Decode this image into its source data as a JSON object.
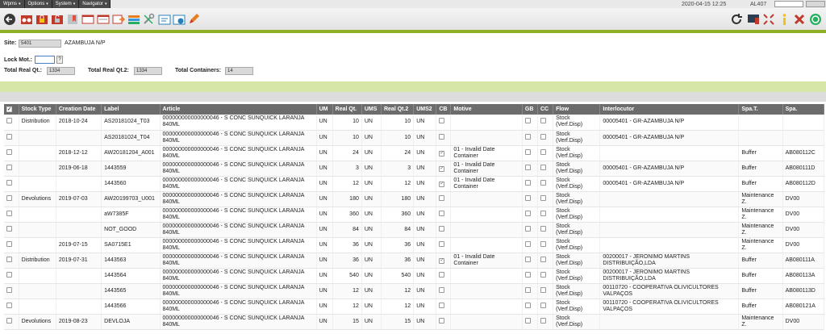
{
  "menu": {
    "items": [
      {
        "label": "Wpms"
      },
      {
        "label": "Options"
      },
      {
        "label": "System"
      },
      {
        "label": "Navigator"
      }
    ],
    "date": "2020-04-15 12:25",
    "user": "AL407"
  },
  "toolbar": {
    "left_icons": [
      "back-arrow-icon",
      "binoculars-icon",
      "lock-icon",
      "unlock-icon",
      "bookmark-icon",
      "window-icon",
      "form-arrow-icon",
      "list-icon",
      "tools-icon",
      "note-icon",
      "globe-window-icon",
      "pencil-icon"
    ],
    "right_icons": [
      "refresh-icon",
      "monitor-icon",
      "expand-icon",
      "info-icon",
      "close-icon",
      "exit-icon"
    ]
  },
  "form": {
    "site_label": "Site:",
    "site_value": "5401",
    "site_name": "AZAMBUJA N/P",
    "lock_label": "Lock Mot.:",
    "lock_btn": "?",
    "total_real_label": "Total Real Qt.:",
    "total_real_value": "1334",
    "total_real2_label": "Total Real Qt.2:",
    "total_real2_value": "1334",
    "total_containers_label": "Total Containers:",
    "total_containers_value": "14"
  },
  "table": {
    "headers": [
      "",
      "Stock Type",
      "Creation Date",
      "Label",
      "Article",
      "UM",
      "Real Qt.",
      "UMS",
      "Real Qt.2",
      "UMS2",
      "CB",
      "Motive",
      "GB",
      "CC",
      "Flow",
      "Interlocutor",
      "Spa.T.",
      "Spa."
    ],
    "rows": [
      {
        "stock_type": "Distribution",
        "date": "2018-10-24",
        "label": "AS20181024_T03",
        "article": "000000000000000046 - S CONC SUNQUICK LARANJA 840ML",
        "um": "UN",
        "real": "10",
        "ums": "UN",
        "real2": "10",
        "ums2": "UN",
        "cb": false,
        "motive": "",
        "flow": "Stock (Verf.Disp)",
        "interlocutor": "00005401 - GR-AZAMBUJA N/P",
        "spat": "",
        "spa": ""
      },
      {
        "stock_type": "",
        "date": "",
        "label": "AS20181024_T04",
        "article": "000000000000000046 - S CONC SUNQUICK LARANJA 840ML",
        "um": "UN",
        "real": "10",
        "ums": "UN",
        "real2": "10",
        "ums2": "UN",
        "cb": false,
        "motive": "",
        "flow": "Stock (Verf.Disp)",
        "interlocutor": "00005401 - GR-AZAMBUJA N/P",
        "spat": "",
        "spa": ""
      },
      {
        "stock_type": "",
        "date": "2018-12-12",
        "label": "AW20181204_A001",
        "article": "000000000000000046 - S CONC SUNQUICK LARANJA 840ML",
        "um": "UN",
        "real": "24",
        "ums": "UN",
        "real2": "24",
        "ums2": "UN",
        "cb": true,
        "motive": "01 - Invalid Date Container",
        "flow": "Stock (Verf.Disp)",
        "interlocutor": "",
        "spat": "Buffer",
        "spa": "AB080112C"
      },
      {
        "stock_type": "",
        "date": "2019-06-18",
        "label": "1443559",
        "article": "000000000000000046 - S CONC SUNQUICK LARANJA 840ML",
        "um": "UN",
        "real": "3",
        "ums": "UN",
        "real2": "3",
        "ums2": "UN",
        "cb": true,
        "motive": "01 - Invalid Date Container",
        "flow": "Stock (Verf.Disp)",
        "interlocutor": "00005401 - GR-AZAMBUJA N/P",
        "spat": "Buffer",
        "spa": "AB080111D"
      },
      {
        "stock_type": "",
        "date": "",
        "label": "1443560",
        "article": "000000000000000046 - S CONC SUNQUICK LARANJA 840ML",
        "um": "UN",
        "real": "12",
        "ums": "UN",
        "real2": "12",
        "ums2": "UN",
        "cb": true,
        "motive": "01 - Invalid Date Container",
        "flow": "Stock (Verf.Disp)",
        "interlocutor": "00005401 - GR-AZAMBUJA N/P",
        "spat": "Buffer",
        "spa": "AB080112D"
      },
      {
        "stock_type": "Devolutions",
        "date": "2019-07-03",
        "label": "AW20199703_U001",
        "article": "000000000000000046 - S CONC SUNQUICK LARANJA 840ML",
        "um": "UN",
        "real": "180",
        "ums": "UN",
        "real2": "180",
        "ums2": "UN",
        "cb": false,
        "motive": "",
        "flow": "Stock (Verf.Disp)",
        "interlocutor": "",
        "spat": "Maintenance Z.",
        "spa": "DV00"
      },
      {
        "stock_type": "",
        "date": "",
        "label": "aW7385F",
        "article": "000000000000000046 - S CONC SUNQUICK LARANJA 840ML",
        "um": "UN",
        "real": "360",
        "ums": "UN",
        "real2": "360",
        "ums2": "UN",
        "cb": false,
        "motive": "",
        "flow": "Stock (Verf.Disp)",
        "interlocutor": "",
        "spat": "Maintenance Z.",
        "spa": "DV00"
      },
      {
        "stock_type": "",
        "date": "",
        "label": "NOT_GOOD",
        "article": "000000000000000046 - S CONC SUNQUICK LARANJA 840ML",
        "um": "UN",
        "real": "84",
        "ums": "UN",
        "real2": "84",
        "ums2": "UN",
        "cb": false,
        "motive": "",
        "flow": "Stock (Verf.Disp)",
        "interlocutor": "",
        "spat": "Maintenance Z.",
        "spa": "DV00"
      },
      {
        "stock_type": "",
        "date": "2019-07-15",
        "label": "SA0715E1",
        "article": "000000000000000046 - S CONC SUNQUICK LARANJA 840ML",
        "um": "UN",
        "real": "36",
        "ums": "UN",
        "real2": "36",
        "ums2": "UN",
        "cb": false,
        "motive": "",
        "flow": "Stock (Verf.Disp)",
        "interlocutor": "",
        "spat": "Maintenance Z.",
        "spa": "DV00"
      },
      {
        "stock_type": "Distribution",
        "date": "2019-07-31",
        "label": "1443563",
        "article": "000000000000000046 - S CONC SUNQUICK LARANJA 840ML",
        "um": "UN",
        "real": "36",
        "ums": "UN",
        "real2": "36",
        "ums2": "UN",
        "cb": true,
        "motive": "01 - Invalid Date Container",
        "flow": "Stock (Verf.Disp)",
        "interlocutor": "00200017 - JERONIMO MARTINS DISTRIBUIÇÃO,LDA",
        "spat": "Buffer",
        "spa": "AB080111A"
      },
      {
        "stock_type": "",
        "date": "",
        "label": "1443564",
        "article": "000000000000000046 - S CONC SUNQUICK LARANJA 840ML",
        "um": "UN",
        "real": "540",
        "ums": "UN",
        "real2": "540",
        "ums2": "UN",
        "cb": false,
        "motive": "",
        "flow": "Stock (Verf.Disp)",
        "interlocutor": "00200017 - JERONIMO MARTINS DISTRIBUIÇÃO,LDA",
        "spat": "Buffer",
        "spa": "AB080113A"
      },
      {
        "stock_type": "",
        "date": "",
        "label": "1443565",
        "article": "000000000000000046 - S CONC SUNQUICK LARANJA 840ML",
        "um": "UN",
        "real": "12",
        "ums": "UN",
        "real2": "12",
        "ums2": "UN",
        "cb": false,
        "motive": "",
        "flow": "Stock (Verf.Disp)",
        "interlocutor": "00110720 - COOPERATIVA OLIVICULTORES VALPAÇOS",
        "spat": "Buffer",
        "spa": "AB080113D"
      },
      {
        "stock_type": "",
        "date": "",
        "label": "1443566",
        "article": "000000000000000046 - S CONC SUNQUICK LARANJA 840ML",
        "um": "UN",
        "real": "12",
        "ums": "UN",
        "real2": "12",
        "ums2": "UN",
        "cb": false,
        "motive": "",
        "flow": "Stock (Verf.Disp)",
        "interlocutor": "00110720 - COOPERATIVA OLIVICULTORES VALPAÇOS",
        "spat": "Buffer",
        "spa": "AB080121A"
      },
      {
        "stock_type": "Devolutions",
        "date": "2019-08-23",
        "label": "DEVLOJA",
        "article": "000000000000000046 - S CONC SUNQUICK LARANJA 840ML",
        "um": "UN",
        "real": "15",
        "ums": "UN",
        "real2": "15",
        "ums2": "UN",
        "cb": false,
        "motive": "",
        "flow": "Stock (Verf.Disp)",
        "interlocutor": "",
        "spat": "Maintenance Z.",
        "spa": "DV00"
      }
    ]
  }
}
